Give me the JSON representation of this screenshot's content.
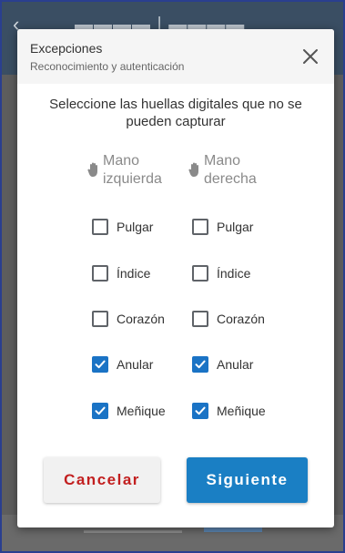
{
  "dialog": {
    "title": "Excepciones",
    "subtitle": "Reconocimiento y autenticación",
    "instruction": "Seleccione las huellas digitales que no se pueden capturar"
  },
  "hands": {
    "left_line1": "Mano",
    "left_line2": "izquierda",
    "right_line1": "Mano",
    "right_line2": "derecha"
  },
  "fingers": {
    "left": [
      {
        "label": "Pulgar",
        "checked": false
      },
      {
        "label": "Índice",
        "checked": false
      },
      {
        "label": "Corazón",
        "checked": false
      },
      {
        "label": "Anular",
        "checked": true
      },
      {
        "label": "Meñique",
        "checked": true
      }
    ],
    "right": [
      {
        "label": "Pulgar",
        "checked": false
      },
      {
        "label": "Índice",
        "checked": false
      },
      {
        "label": "Corazón",
        "checked": false
      },
      {
        "label": "Anular",
        "checked": true
      },
      {
        "label": "Meñique",
        "checked": true
      }
    ]
  },
  "buttons": {
    "cancel": "Cancelar",
    "next": "Siguiente"
  },
  "colors": {
    "accent": "#1a7fc4",
    "checkbox_checked": "#1a73c5",
    "cancel_text": "#c21f1f"
  },
  "icons": {
    "close": "close-icon",
    "hand": "hand-icon",
    "check": "check-icon"
  }
}
